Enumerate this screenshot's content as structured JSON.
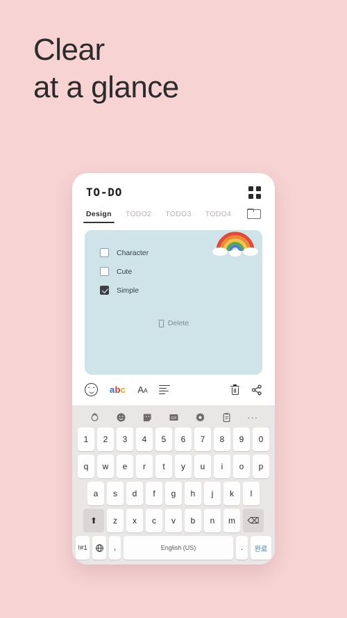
{
  "page": {
    "background_color": "#f7d3d3",
    "headline": "Clear\nat a glance"
  },
  "app": {
    "title": "TO-DO",
    "grid_icon": "grid-view-icon",
    "folder_icon": "folder-icon",
    "tabs": [
      {
        "label": "Design",
        "active": true
      },
      {
        "label": "TODO2",
        "active": false
      },
      {
        "label": "TODO3",
        "active": false
      },
      {
        "label": "TODO4",
        "active": false
      }
    ]
  },
  "note": {
    "background_color": "#cfe4e8",
    "sticker": "rainbow-sticker",
    "checklist": [
      {
        "label": "Character",
        "checked": false
      },
      {
        "label": "Cute",
        "checked": false
      },
      {
        "label": "Simple",
        "checked": true
      }
    ],
    "delete_label": "Delete"
  },
  "editor_toolbar": {
    "items": [
      {
        "name": "emoji-face-icon"
      },
      {
        "name": "font-color-icon",
        "letters": [
          "a",
          "b",
          "c"
        ]
      },
      {
        "name": "text-size-icon",
        "label": "Aa"
      },
      {
        "name": "align-left-icon"
      }
    ],
    "delete_icon": "trash-icon",
    "share_icon": "share-icon",
    "abc": {
      "a": "a",
      "b": "b",
      "c": "c"
    },
    "aa_big": "A",
    "aa_small": "A"
  },
  "keyboard": {
    "toolbar_icons": [
      "search-rotate-icon",
      "emoji-icon",
      "sticker-icon",
      "gif-icon",
      "settings-gear-icon",
      "clipboard-icon",
      "more-options-icon"
    ],
    "gif_label": "GIF",
    "more_label": "···",
    "rows": {
      "numbers": [
        "1",
        "2",
        "3",
        "4",
        "5",
        "6",
        "7",
        "8",
        "9",
        "0"
      ],
      "top": [
        "q",
        "w",
        "e",
        "r",
        "t",
        "y",
        "u",
        "i",
        "o",
        "p"
      ],
      "home": [
        "a",
        "s",
        "d",
        "f",
        "g",
        "h",
        "j",
        "k",
        "l"
      ],
      "bottom": [
        "z",
        "x",
        "c",
        "v",
        "b",
        "n",
        "m"
      ]
    },
    "shift_key": "⬆",
    "backspace_key": "⌫",
    "symbols_key": "!#1",
    "language_key": "globe-icon",
    "comma_key": ",",
    "space_key": "English (US)",
    "period_key": ".",
    "done_key": "완료",
    "done_key_color": "#3e82c4"
  }
}
